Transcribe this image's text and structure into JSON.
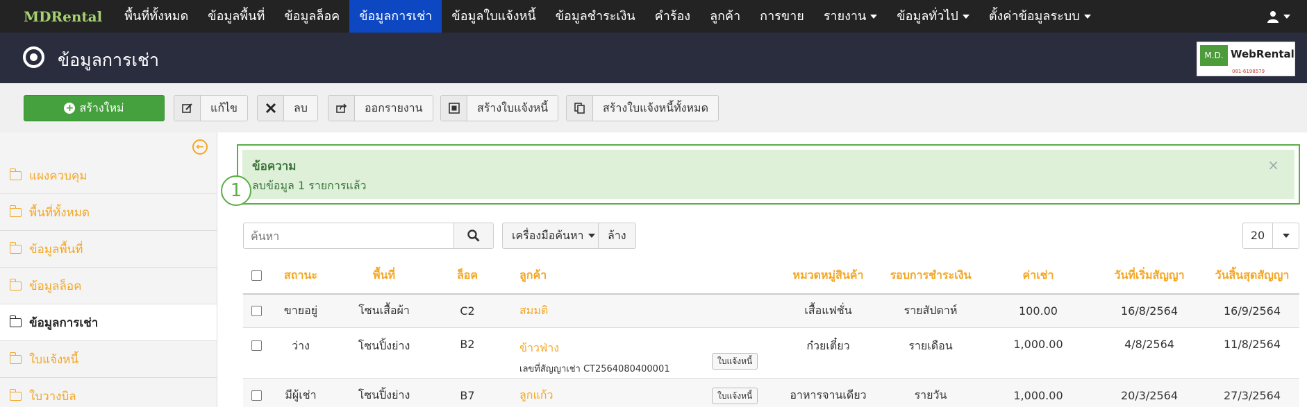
{
  "nav": {
    "brand": "MDRental",
    "items": [
      "พื้นที่ทั้งหมด",
      "ข้อมูลพื้นที่",
      "ข้อมูลล็อค",
      "ข้อมูลการเช่า",
      "ข้อมูลใบแจ้งหนี้",
      "ข้อมูลชำระเงิน",
      "คำร้อง",
      "ลูกค้า",
      "การขาย",
      "รายงาน",
      "ข้อมูลทั่วไป",
      "ตั้งค่าข้อมูลระบบ"
    ],
    "active_index": 3
  },
  "page": {
    "title": "ข้อมูลการเช่า"
  },
  "logo": {
    "left": "M.D.",
    "right": "WebRental",
    "sub": "081-6198579"
  },
  "toolbar": {
    "create": "สร้างใหม่",
    "edit": "แก้ไข",
    "delete": "ลบ",
    "export": "ออกรายงาน",
    "create_invoice": "สร้างใบแจ้งหนี้",
    "create_all_invoices": "สร้างใบแจ้งหนี้ทั้งหมด"
  },
  "sidebar": {
    "items": [
      "แผงควบคุม",
      "พื้นที่ทั้งหมด",
      "ข้อมูลพื้นที่",
      "ข้อมูลล็อค",
      "ข้อมูลการเช่า",
      "ใบแจ้งหนี้",
      "ใบวางบิล"
    ],
    "active_index": 4
  },
  "alert": {
    "title": "ข้อความ",
    "message": "ลบข้อมูล 1 รายการแล้ว",
    "close": "×",
    "callout": "1"
  },
  "search": {
    "placeholder": "ค้นหา",
    "tools": "เครื่องมือค้นหา",
    "clear": "ล้าง",
    "page_size": "20"
  },
  "table": {
    "headers": {
      "status": "สถานะ",
      "area": "พื้นที่",
      "lock": "ล็อค",
      "customer": "ลูกค้า",
      "category": "หมวดหมู่สินค้า",
      "cycle": "รอบการชำระเงิน",
      "rent": "ค่าเช่า",
      "start": "วันที่เริ่มสัญญา",
      "end": "วันสิ้นสุดสัญญา"
    },
    "rows": [
      {
        "status": "ขายอยู่",
        "area": "โซนเสื้อผ้า",
        "lock": "C2",
        "customer": "สมมติ",
        "contract": "",
        "invoice": "",
        "category": "เสื้อแฟชั่น",
        "cycle": "รายสัปดาห์",
        "rent": "100.00",
        "start": "16/8/2564",
        "end": "16/9/2564"
      },
      {
        "status": "ว่าง",
        "area": "โซนปิ้งย่าง",
        "lock": "B2",
        "customer": "ข้าวฟ่าง",
        "contract": "เลขที่สัญญาเช่า CT2564080400001",
        "invoice": "ใบแจ้งหนี้",
        "category": "ก๋วยเตี๋ยว",
        "cycle": "รายเดือน",
        "rent": "1,000.00",
        "start": "4/8/2564",
        "end": "11/8/2564"
      },
      {
        "status": "มีผู้เช่า",
        "area": "โซนปิ้งย่าง",
        "lock": "B7",
        "customer": "ลูกแก้ว",
        "contract": "",
        "invoice": "ใบแจ้งหนี้",
        "category": "อาหารจานเดียว",
        "cycle": "รายวัน",
        "rent": "1,000.00",
        "start": "20/3/2564",
        "end": "27/3/2564"
      }
    ]
  }
}
